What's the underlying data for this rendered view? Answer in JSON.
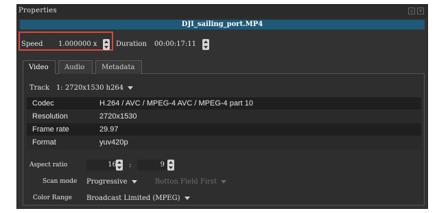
{
  "window": {
    "title": "Properties",
    "file_name": "DJI_sailing_port.MP4"
  },
  "top_controls": {
    "speed_label": "Speed",
    "speed_value": "1.000000 x",
    "duration_label": "Duration",
    "duration_value": "00:00:17:11"
  },
  "tabs": [
    {
      "label": "Video",
      "active": true
    },
    {
      "label": "Audio",
      "active": false
    },
    {
      "label": "Metadata",
      "active": false
    }
  ],
  "video": {
    "track_label": "Track",
    "track_value": "1: 2720x1530 h264",
    "properties": [
      {
        "key": "Codec",
        "value": "H.264 / AVC / MPEG-4 AVC / MPEG-4 part 10"
      },
      {
        "key": "Resolution",
        "value": "2720x1530"
      },
      {
        "key": "Frame rate",
        "value": "29.97"
      },
      {
        "key": "Format",
        "value": "yuv420p"
      }
    ],
    "aspect_ratio_label": "Aspect ratio",
    "aspect_w": "16",
    "aspect_sep": ":",
    "aspect_h": "9",
    "scan_mode_label": "Scan mode",
    "scan_mode_value": "Progressive",
    "field_order_value": "Botton Field First",
    "color_range_label": "Color Range",
    "color_range_value": "Broadcast Limited (MPEG)"
  },
  "colors": {
    "highlight_border": "#e0463b",
    "file_bar": "#1e5a78"
  }
}
